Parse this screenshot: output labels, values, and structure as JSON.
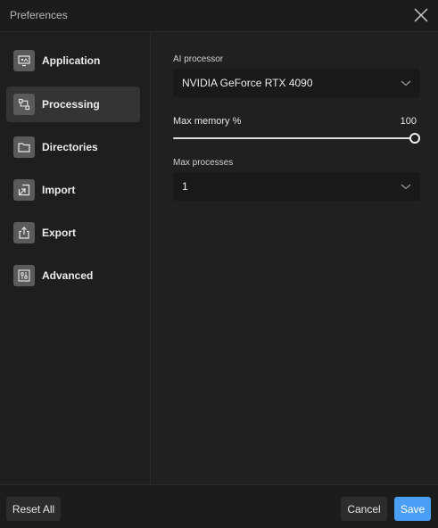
{
  "window": {
    "title": "Preferences"
  },
  "sidebar": {
    "items": [
      {
        "label": "Application",
        "icon": "monitor-icon",
        "active": false
      },
      {
        "label": "Processing",
        "icon": "processing-icon",
        "active": true
      },
      {
        "label": "Directories",
        "icon": "folder-icon",
        "active": false
      },
      {
        "label": "Import",
        "icon": "import-icon",
        "active": false
      },
      {
        "label": "Export",
        "icon": "export-icon",
        "active": false
      },
      {
        "label": "Advanced",
        "icon": "sliders-icon",
        "active": false
      }
    ]
  },
  "processing": {
    "ai_processor": {
      "label": "AI processor",
      "value": "NVIDIA GeForce RTX 4090"
    },
    "max_memory": {
      "label": "Max memory %",
      "value": "100",
      "fraction": 1.0
    },
    "max_processes": {
      "label": "Max processes",
      "value": "1"
    }
  },
  "footer": {
    "reset_label": "Reset All",
    "cancel_label": "Cancel",
    "save_label": "Save"
  },
  "colors": {
    "accent": "#4a9ff5",
    "background": "#1e1e1e",
    "active_item": "#343434"
  }
}
